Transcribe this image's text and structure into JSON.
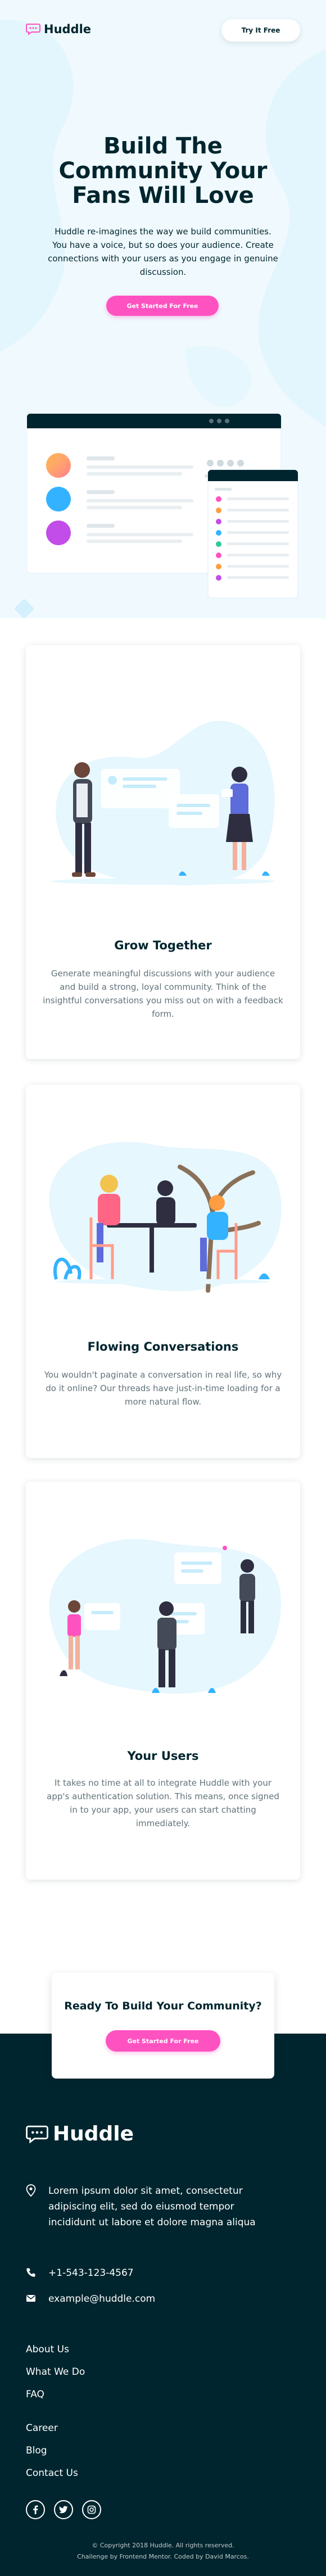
{
  "header": {
    "logo_text": "Huddle",
    "cta_label": "Try It Free"
  },
  "hero": {
    "title_line1": "Build The",
    "title_line2": "Community Your",
    "title_line3": "Fans Will Love",
    "description": "Huddle re-imagines the way we build communities. You have a voice, but so does your audience. Create connections with your users as you engage in genuine discussion.",
    "button_label": "Get Started For Free"
  },
  "features": [
    {
      "title": "Grow Together",
      "text": "Generate meaningful discussions with your audience and build a strong, loyal community. Think of the insightful conversations you miss out on with a feedback form."
    },
    {
      "title": "Flowing Conversations",
      "text": "You wouldn't paginate a conversation in real life, so why do it online? Our threads have just-in-time loading for a more natural flow."
    },
    {
      "title": "Your Users",
      "text": "It takes no time at all to integrate Huddle with your app's authentication solution. This means, once signed in to your app, your users can start chatting immediately."
    }
  ],
  "cta": {
    "title": "Ready To Build Your Community?",
    "button_label": "Get Started For Free"
  },
  "footer": {
    "logo_text": "Huddle",
    "address": "Lorem ipsum dolor sit amet, consectetur adipiscing elit, sed do eiusmod tempor incididunt ut labore et dolore magna aliqua",
    "phone": "+1-543-123-4567",
    "email": "example@huddle.com",
    "links": [
      "About Us",
      "What We Do",
      "FAQ",
      "Career",
      "Blog",
      "Contact Us"
    ],
    "social_icons": [
      "facebook-icon",
      "twitter-icon",
      "instagram-icon"
    ],
    "copyright": "© Copyright 2018 Huddle. All rights reserved.",
    "credit": "Challenge by Frontend Mentor. Coded by David Marcos."
  },
  "colors": {
    "dark_cyan": "#00252e",
    "pink": "#ff52c1",
    "light_blue_bg": "#f0fafe",
    "grey_text": "#62737a"
  }
}
